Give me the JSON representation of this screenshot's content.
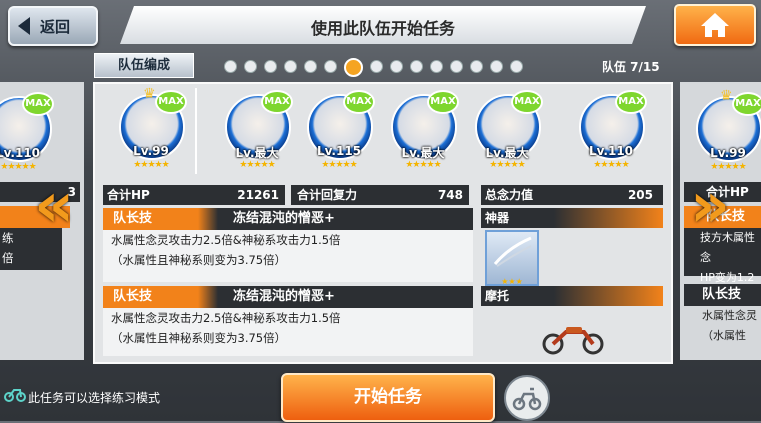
{
  "header": {
    "back_label": "返回",
    "title": "使用此队伍开始任务"
  },
  "subheader": {
    "tab_label": "队伍编成",
    "team_count": "队伍 7/15",
    "page_dots": 15,
    "active_dot": 7
  },
  "portraits": [
    {
      "level": "Lv.99",
      "max": "MAX",
      "crown": true
    },
    {
      "level": "Lv.最大",
      "max": "MAX",
      "crown": false
    },
    {
      "level": "Lv.115",
      "max": "MAX",
      "crown": false
    },
    {
      "level": "Lv.最大",
      "max": "MAX",
      "crown": false
    },
    {
      "level": "Lv.最大",
      "max": "MAX",
      "crown": false
    },
    {
      "level": "Lv.110",
      "max": "MAX",
      "crown": false
    }
  ],
  "stars": "★★★★★",
  "stats": {
    "hp_label": "合计HP",
    "hp_value": "21261",
    "recovery_label": "合计回复力",
    "recovery_value": "748",
    "power_label": "总念力值",
    "power_value": "205"
  },
  "skills": [
    {
      "label": "队长技",
      "name": "冻结混沌的憎恶+",
      "desc1": "水属性念灵攻击力2.5倍&神秘系攻击力1.5倍",
      "desc2": "（水属性且神秘系则变为3.75倍）"
    },
    {
      "label": "队长技",
      "name": "冻结混沌的憎恶+",
      "desc1": "水属性念灵攻击力2.5倍&神秘系攻击力1.5倍",
      "desc2": "（水属性且神秘系则变为3.75倍）"
    }
  ],
  "artifact": {
    "label": "神器",
    "stars": "★★★"
  },
  "vehicle": {
    "label": "摩托"
  },
  "left_peek": {
    "level": "Lv.110",
    "max": "MAX",
    "stat_fragment": "3",
    "text1": "练",
    "text2": "倍"
  },
  "right_peek": {
    "level": "Lv.99",
    "max": "MAX",
    "hp_label": "合计HP",
    "skill_label": "队长技",
    "desc1": "技方木属性念",
    "desc2": "HP变为1.2",
    "skill2_label": "队长技",
    "skill2_desc1": "水属性念灵",
    "skill2_desc2": "（水属性"
  },
  "bottom": {
    "practice_text": "此任务可以选择练习模式",
    "start_label": "开始任务"
  },
  "colors": {
    "accent": "#f2821a",
    "dark": "#2c2f33",
    "max_badge": "#7ed62e",
    "ring": "#1c6fd6"
  }
}
